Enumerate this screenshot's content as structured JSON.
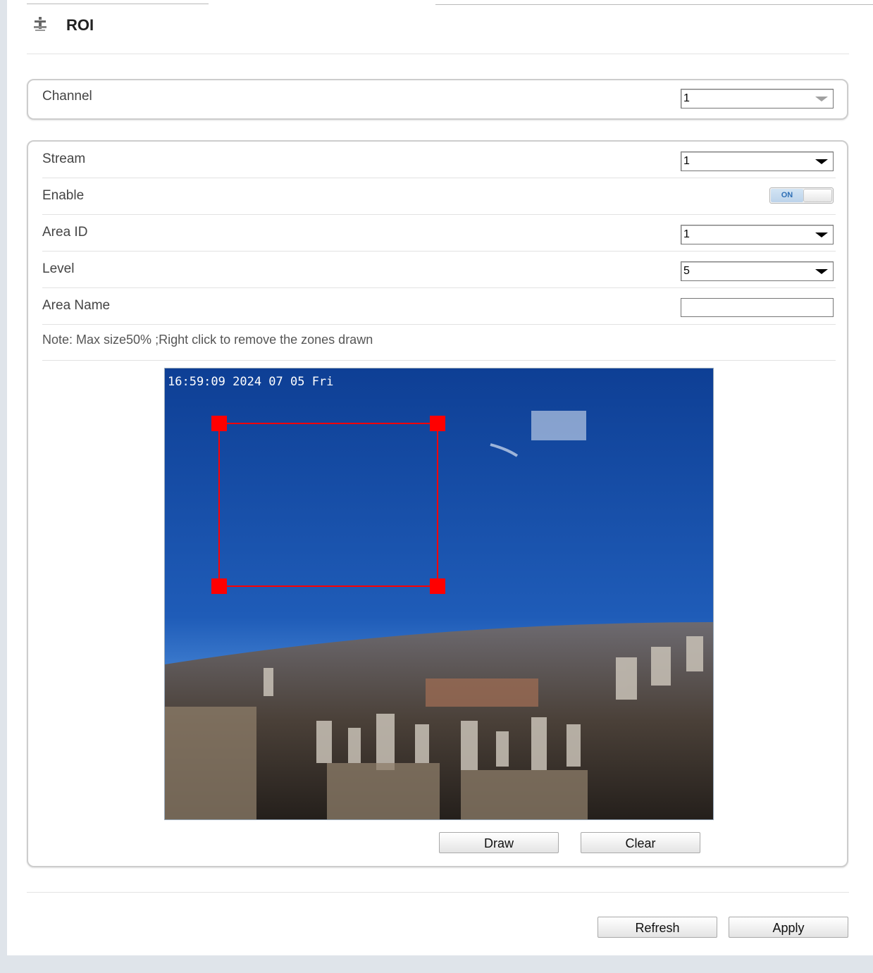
{
  "header": {
    "title": "ROI",
    "icon": "network-icon"
  },
  "channel": {
    "label": "Channel",
    "value": "1"
  },
  "stream": {
    "label": "Stream",
    "value": "1"
  },
  "enable": {
    "label": "Enable",
    "state": "ON"
  },
  "area_id": {
    "label": "Area ID",
    "value": "1"
  },
  "level": {
    "label": "Level",
    "value": "5"
  },
  "area_name": {
    "label": "Area Name",
    "value": ""
  },
  "note": "Note: Max size50% ;Right click to remove the zones drawn",
  "video": {
    "timestamp": "16:59:09 2024 07 05 Fri"
  },
  "buttons": {
    "draw": "Draw",
    "clear": "Clear",
    "refresh": "Refresh",
    "apply": "Apply"
  },
  "colors": {
    "roi": "#ff0000",
    "sky_top": "#0e3f95",
    "sky_bottom": "#4b8ad8",
    "toggle_on": "#2e6fb5"
  }
}
